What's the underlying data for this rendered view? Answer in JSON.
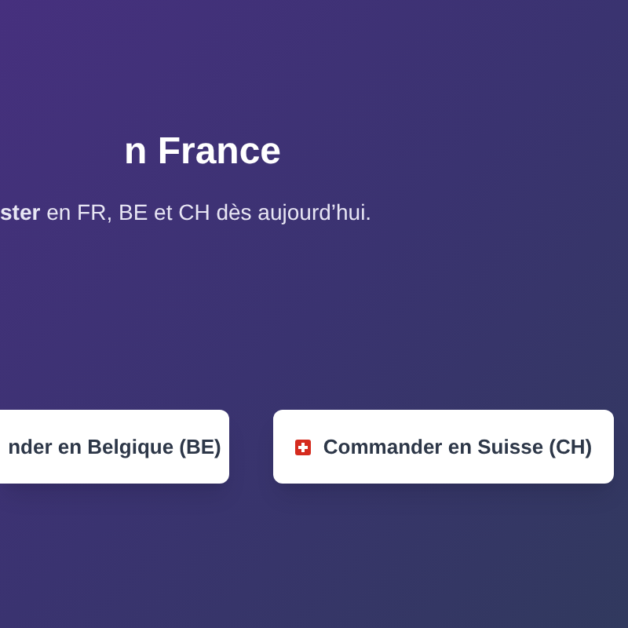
{
  "hero": {
    "title": "n France",
    "subtitle": "**ster** en FR, BE et CH dès aujourd’hui."
  },
  "buttons": [
    {
      "label": "nder en Belgique (BE)",
      "kind": "plain"
    },
    {
      "label": "Commander en Suisse (CH)",
      "kind": "flag"
    }
  ]
}
